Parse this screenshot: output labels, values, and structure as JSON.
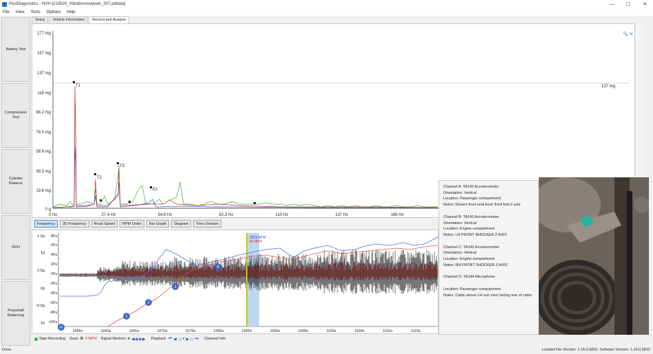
{
  "window": {
    "title": "PicoDiagnostics - NVH [210526_VibrationAnalyser_007.pddata]",
    "minimize": "—",
    "maximize": "▢",
    "close": "✕"
  },
  "menu": [
    "File",
    "View",
    "Tests",
    "Options",
    "Help"
  ],
  "sidebar": [
    "Battery Test",
    "Compression Test",
    "Cylinder Balance",
    "NVH",
    "Propshaft Balancing"
  ],
  "tabs": [
    "Setup",
    "Vehicle Information",
    "Record and Analyze"
  ],
  "spectrum": {
    "y_ticks": [
      "177 mg",
      "157 mg",
      "137 mg",
      "118 mg",
      "98.2 mg",
      "78.5 mg",
      "58.9 mg",
      "39.3 mg",
      "19.6 mg",
      "0 g"
    ],
    "x_ticks": [
      "0 Hz",
      "27.4 Hz",
      "54.8 Hz",
      "82.3 Hz",
      "110 Hz",
      "137 Hz",
      "165 Hz"
    ],
    "threshold_label": "127 mg",
    "markers": [
      "T1",
      "T2",
      "T3",
      "E1"
    ]
  },
  "view_buttons": [
    "Frequency",
    "3D Frequency",
    "Road Speed",
    "RPM Order",
    "Bar Graph",
    "Diagram",
    "Time Domain"
  ],
  "time_plot": {
    "left_ticks": [
      "1.5g",
      "1g",
      "0.5g",
      "0g",
      "-0.5g",
      "-1g"
    ],
    "right_ticks": [
      "8Pa",
      "6Pa",
      "4Pa",
      "2Pa",
      "0Pa",
      "-2Pa",
      "-4Pa",
      "-6Pa",
      "-8Pa",
      "-10Pa"
    ],
    "x_ticks": [
      "1055s",
      "1060s",
      "1065s",
      "1070s",
      "1075s",
      "1080s",
      "1085s",
      "1090s",
      "1095s",
      "1100s",
      "1105s",
      "1110s",
      "1115s"
    ],
    "cursor_rpm": "2019 RPM",
    "cursor_mph": "65 MPH",
    "gear_markers": [
      "N",
      "1",
      "2",
      "3",
      "4"
    ]
  },
  "bottombar": {
    "start_recording": "Start Recording",
    "gear_label": "Gear:",
    "gear_value": "N",
    "speed_value": "0 MPH",
    "signal_markers": "Signal Markers",
    "playback": "Playback",
    "channel_info": "Channel Info"
  },
  "channels": [
    {
      "name": "Channel A: TA143 Accelerometer",
      "orientation": "Orientation: Vertical",
      "location": "Location: Passenger compartment",
      "notes": "Notes: Drivers front seat inner front bolt Z axis"
    },
    {
      "name": "Channel B: TA143 Accelerometer",
      "orientation": "Orientation: Vertical",
      "location": "Location: Engine compartment",
      "notes": "Notes: LH FRONT SHOCKER Z AXIS"
    },
    {
      "name": "Channel C: TA143 Accelerometer",
      "orientation": "Orientation: Vertical",
      "location": "Location: Engine compartment",
      "notes": "Notes: RH FRONT SHOCKER Z AXIS"
    },
    {
      "name": "Channel D: TA144 Microphone",
      "orientation": "",
      "location": "Location: Passenger compartment",
      "notes": "Notes: Cabin above LH sun visor facing rear of cabin"
    }
  ],
  "status": {
    "left": "Done.",
    "right": "Loaded File Version: 1.16.0.5810, Software Version: 1.16.0.5810"
  },
  "colors": {
    "ch_a": "#2b4fd6",
    "ch_b": "#d62b2b",
    "ch_c": "#2bb52b",
    "dark_wave": "#6b1212",
    "cursor": "#c8c800"
  }
}
